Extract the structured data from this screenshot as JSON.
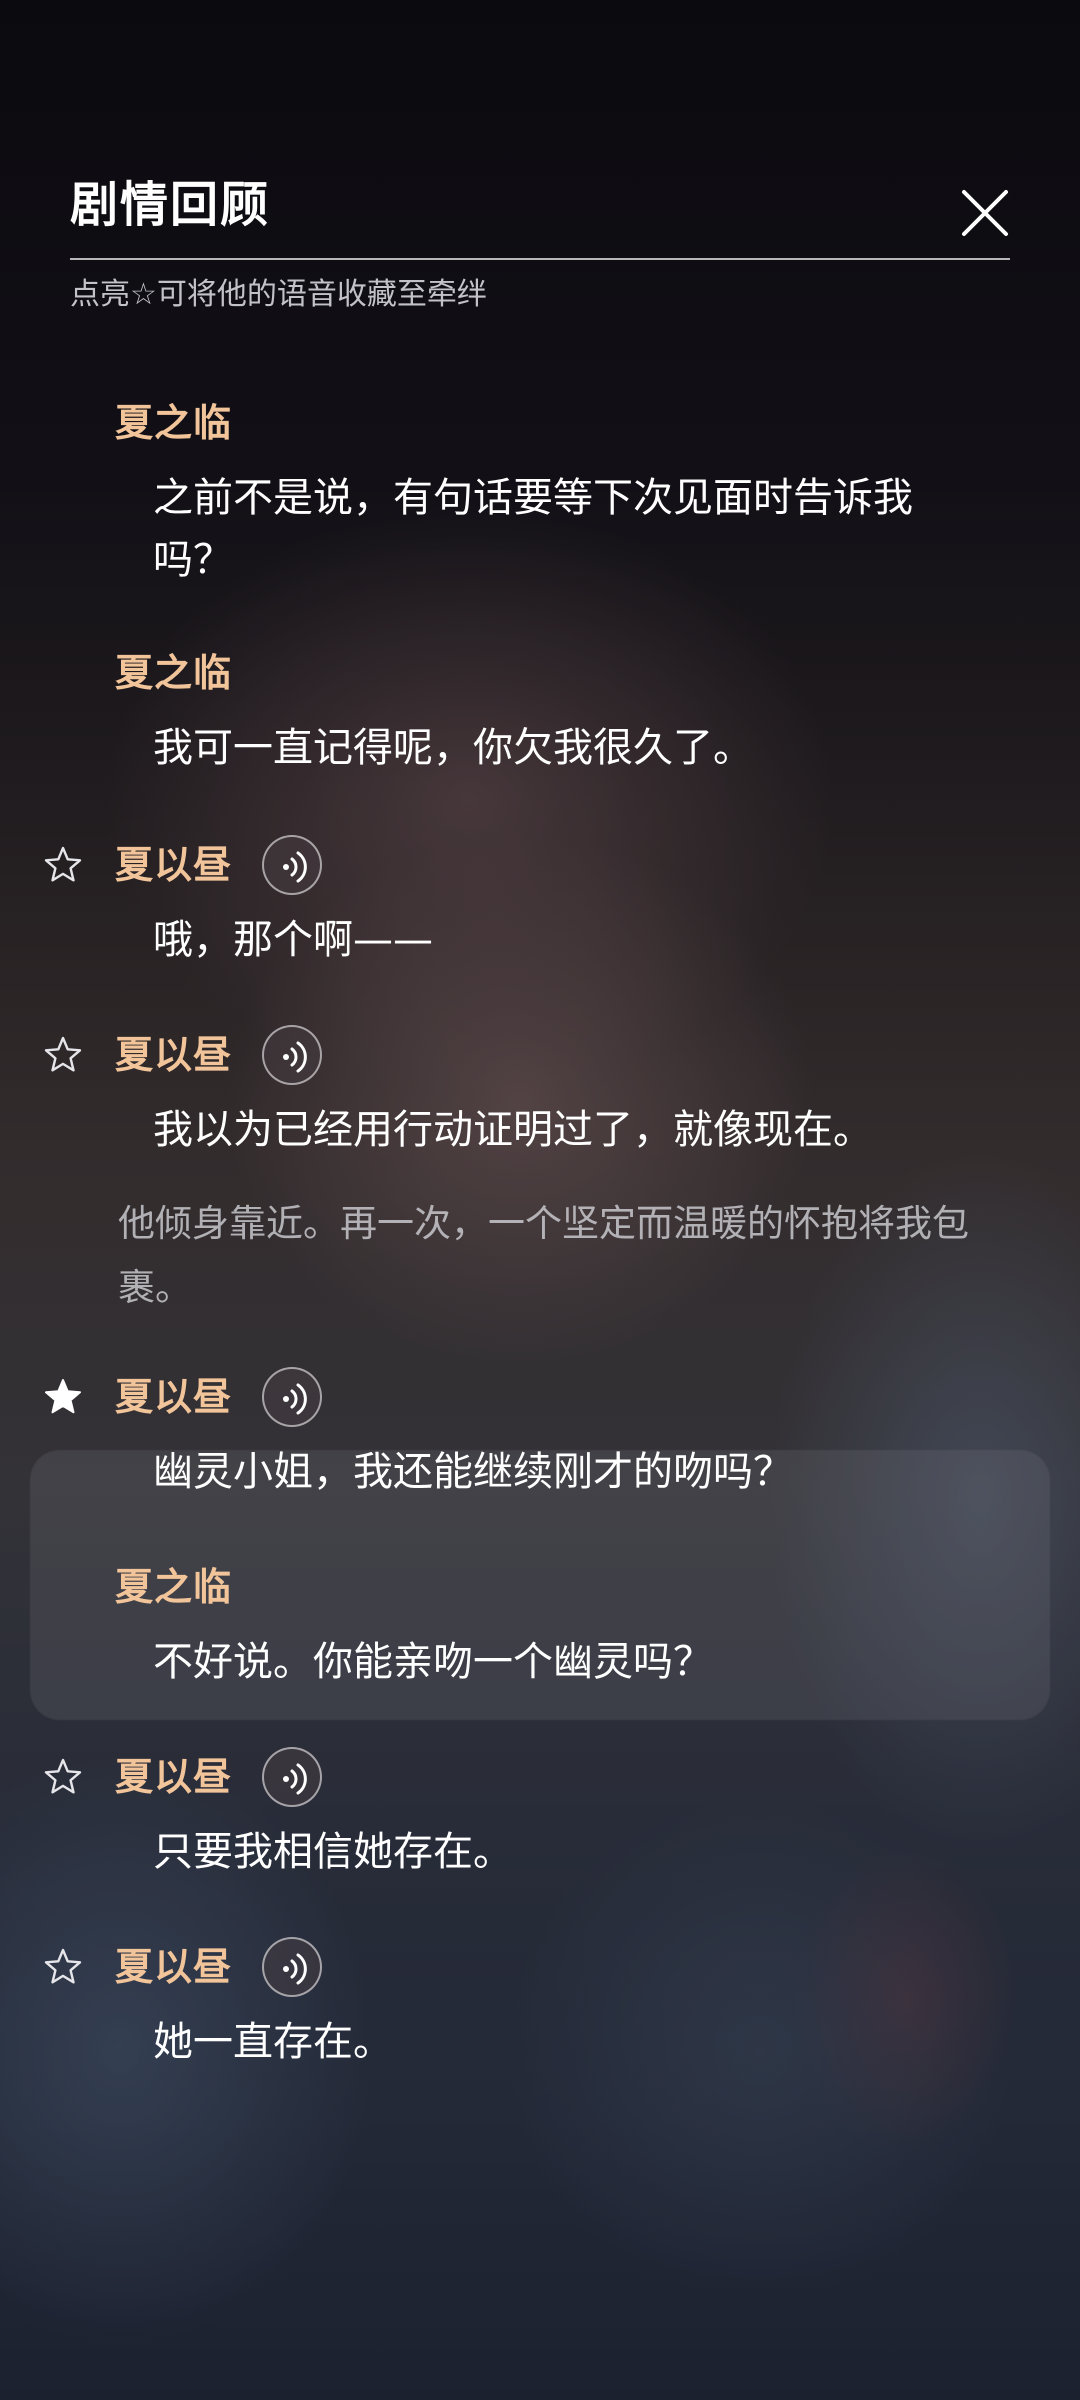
{
  "header": {
    "title": "剧情回顾",
    "hint": "点亮☆可将他的语音收藏至牵绊"
  },
  "messages": [
    {
      "speaker": "夏之临",
      "text": "之前不是说，有句话要等下次见面时告诉我吗？",
      "starred": null,
      "voice": false
    },
    {
      "speaker": "夏之临",
      "text": "我可一直记得呢，你欠我很久了。",
      "starred": null,
      "voice": false
    },
    {
      "speaker": "夏以昼",
      "text": "哦，那个啊——",
      "starred": false,
      "voice": true
    },
    {
      "speaker": "夏以昼",
      "text": "我以为已经用行动证明过了，就像现在。",
      "starred": false,
      "voice": true
    },
    {
      "narration": "他倾身靠近。再一次，一个坚定而温暖的怀抱将我包裹。"
    },
    {
      "speaker": "夏以昼",
      "text": "幽灵小姐，我还能继续刚才的吻吗？",
      "starred": true,
      "voice": true
    },
    {
      "speaker": "夏之临",
      "text": "不好说。你能亲吻一个幽灵吗？",
      "starred": null,
      "voice": false
    },
    {
      "speaker": "夏以昼",
      "text": "只要我相信她存在。",
      "starred": false,
      "voice": true
    },
    {
      "speaker": "夏以昼",
      "text": "她一直存在。",
      "starred": false,
      "voice": true
    }
  ],
  "colors": {
    "speaker": "#f2c49a",
    "text": "#ffffff",
    "narration": "#cdcdd2"
  }
}
